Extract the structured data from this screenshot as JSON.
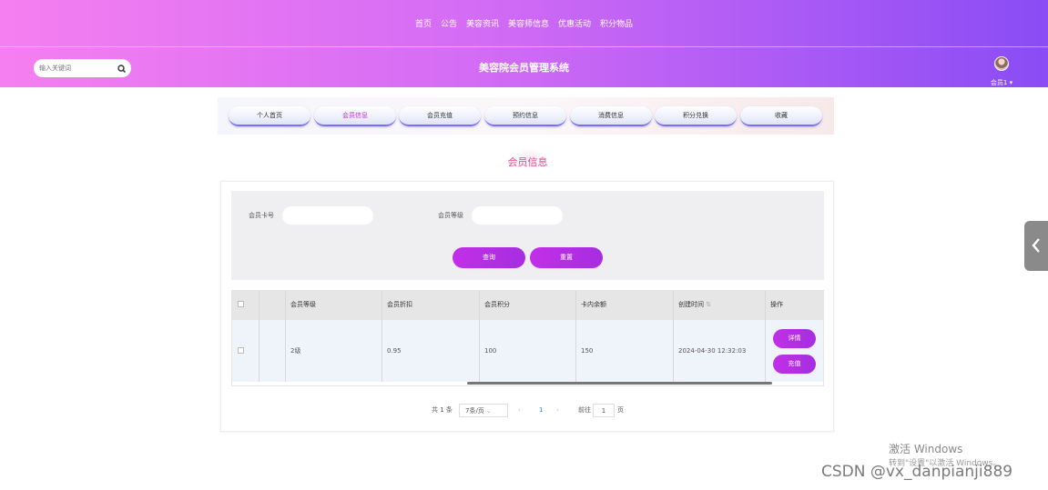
{
  "top_nav": [
    "首页",
    "公告",
    "美容资讯",
    "美容师信息",
    "优惠活动",
    "积分物品"
  ],
  "search": {
    "placeholder": "输入关键词",
    "icon": "search-icon"
  },
  "site_title": "美容院会员管理系统",
  "user": {
    "name": "会员1",
    "avatar": "avatar"
  },
  "tabs": [
    {
      "label": "个人首页",
      "active": false
    },
    {
      "label": "会员信息",
      "active": true
    },
    {
      "label": "会员充值",
      "active": false
    },
    {
      "label": "预约信息",
      "active": false
    },
    {
      "label": "消费信息",
      "active": false
    },
    {
      "label": "积分兑换",
      "active": false
    },
    {
      "label": "收藏",
      "active": false
    }
  ],
  "section_title": "会员信息",
  "filters": {
    "card_label": "会员卡号",
    "card_value": "",
    "level_label": "会员等级",
    "level_value": "",
    "btn1": "查询",
    "btn2": "重置"
  },
  "table": {
    "headers": [
      "会员等级",
      "会员折扣",
      "会员积分",
      "卡内余额",
      "创建时间",
      "操作"
    ],
    "rows": [
      {
        "level": "2级",
        "discount": "0.95",
        "points": "100",
        "balance": "150",
        "created": "2024-04-30 12:32:03",
        "actions": [
          "详情",
          "充值"
        ]
      }
    ]
  },
  "pagination": {
    "total": "共 1 条",
    "page_size": "7条/页",
    "current_page": "1",
    "goto_label": "前往",
    "goto_value": "1",
    "page_suffix": "页"
  },
  "watermark": {
    "line1": "激活 Windows",
    "line2": "转到\"设置\"以激活 Windows。",
    "csdn": "CSDN @vx_danpianji889"
  },
  "colors": {
    "accent": "#c22fe8",
    "header_start": "#f57ff0",
    "header_end": "#8a4cf5",
    "section_title": "#d84c8e"
  }
}
